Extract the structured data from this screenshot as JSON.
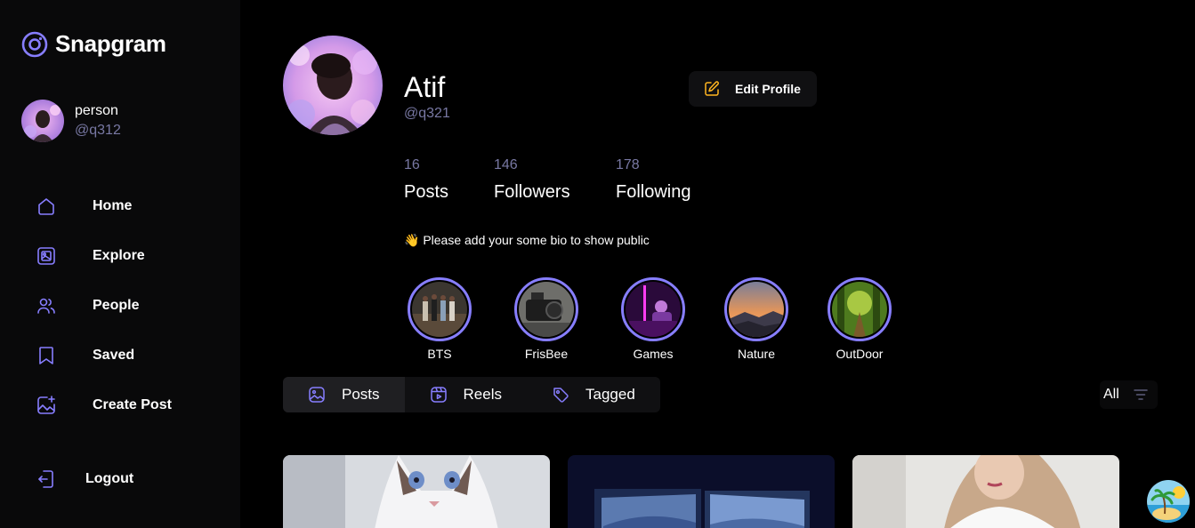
{
  "app": {
    "name": "Snapgram",
    "accent": "#877eff"
  },
  "current_user": {
    "name": "person",
    "handle": "@q312"
  },
  "nav": {
    "items": [
      {
        "label": "Home",
        "icon": "home-icon"
      },
      {
        "label": "Explore",
        "icon": "explore-icon"
      },
      {
        "label": "People",
        "icon": "people-icon"
      },
      {
        "label": "Saved",
        "icon": "saved-icon"
      },
      {
        "label": "Create Post",
        "icon": "create-post-icon"
      }
    ],
    "logout_label": "Logout"
  },
  "profile": {
    "name": "Atif",
    "handle": "@q321",
    "edit_label": "Edit Profile",
    "stats": [
      {
        "value": "16",
        "label": "Posts"
      },
      {
        "value": "146",
        "label": "Followers"
      },
      {
        "value": "178",
        "label": "Following"
      }
    ],
    "bio": "👋 Please add your some bio to show public"
  },
  "highlights": [
    {
      "label": "BTS"
    },
    {
      "label": "FrisBee"
    },
    {
      "label": "Games"
    },
    {
      "label": "Nature"
    },
    {
      "label": "OutDoor"
    }
  ],
  "tabs": [
    {
      "label": "Posts",
      "active": true
    },
    {
      "label": "Reels",
      "active": false
    },
    {
      "label": "Tagged",
      "active": false
    }
  ],
  "filter": {
    "label": "All"
  }
}
